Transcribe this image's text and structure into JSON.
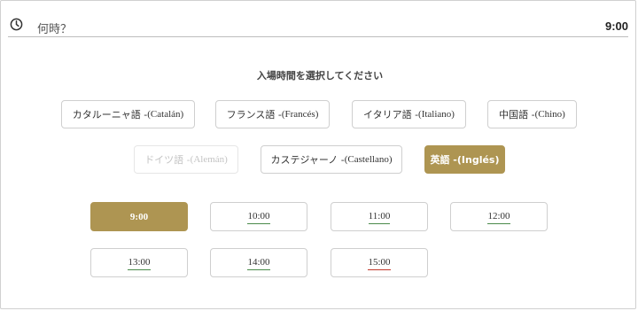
{
  "header": {
    "label": "何時？",
    "selected_time": "9:00",
    "icon": "clock-icon"
  },
  "prompt": "入場時間を選択してください",
  "languages": [
    {
      "jp": "カタルーニャ語 - ",
      "latin": "(Catalán)",
      "state": "normal"
    },
    {
      "jp": "フランス語 - ",
      "latin": "(Francés)",
      "state": "normal"
    },
    {
      "jp": "イタリア語 - ",
      "latin": "(Italiano)",
      "state": "normal"
    },
    {
      "jp": "中国語 - ",
      "latin": "(Chino)",
      "state": "normal"
    },
    {
      "jp": "ドイツ語 - ",
      "latin": "(Alemán)",
      "state": "disabled"
    },
    {
      "jp": "カステジャーノ - ",
      "latin": "(Castellano)",
      "state": "normal"
    },
    {
      "jp": "英語 - ",
      "latin": "(Inglés)",
      "state": "selected"
    }
  ],
  "times": [
    {
      "label": "9:00",
      "state": "selected",
      "underline": "none"
    },
    {
      "label": "10:00",
      "state": "normal",
      "underline": "green"
    },
    {
      "label": "11:00",
      "state": "normal",
      "underline": "green"
    },
    {
      "label": "12:00",
      "state": "normal",
      "underline": "green"
    },
    {
      "label": "13:00",
      "state": "normal",
      "underline": "green"
    },
    {
      "label": "14:00",
      "state": "normal",
      "underline": "green"
    },
    {
      "label": "15:00",
      "state": "normal",
      "underline": "red"
    }
  ],
  "colors": {
    "accent": "#ae9552",
    "available_underline": "#4a8a4a",
    "limited_underline": "#c0392b"
  }
}
